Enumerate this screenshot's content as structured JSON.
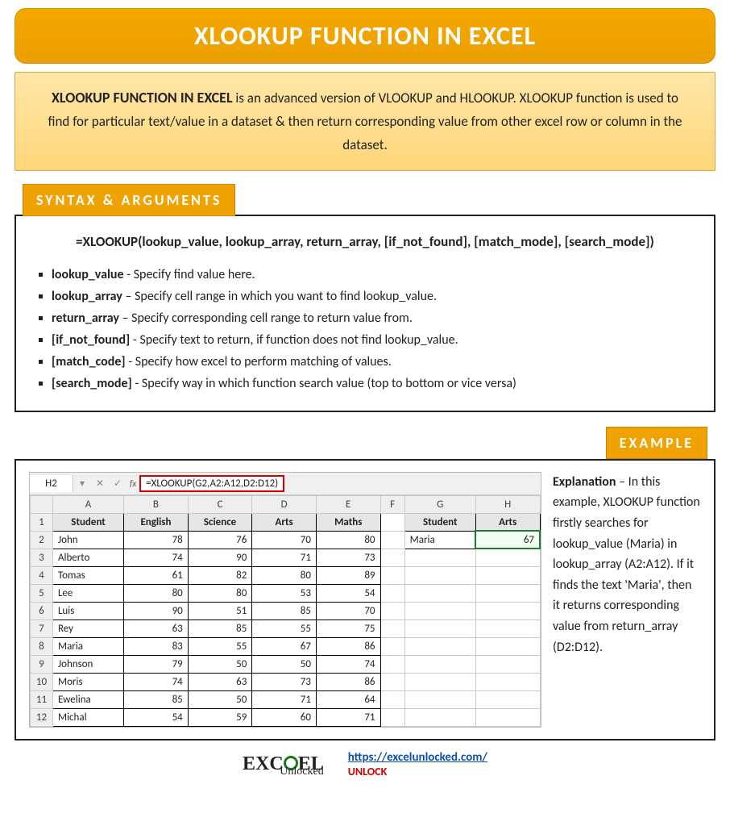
{
  "title": "XLOOKUP FUNCTION IN EXCEL",
  "intro": {
    "lead": "XLOOKUP FUNCTION IN EXCEL",
    "rest": " is an advanced version of VLOOKUP and HLOOKUP. XLOOKUP function is used to find for particular text/value in a dataset & then return corresponding value from other excel row or column in the dataset."
  },
  "sections": {
    "syntax_label": "SYNTAX & ARGUMENTS",
    "example_label": "EXAMPLE"
  },
  "syntax": {
    "formula": "=XLOOKUP(lookup_value, lookup_array, return_array, [if_not_found], [match_mode], [search_mode])",
    "args": [
      {
        "name": "lookup_value",
        "desc": " - Specify find value here."
      },
      {
        "name": "lookup_array",
        "desc": " – Specify cell range in which you want to find lookup_value."
      },
      {
        "name": "return_array",
        "desc": " – Specify corresponding cell range to return value from."
      },
      {
        "name": "[if_not_found]",
        "desc": " - Specify text to return, if function does not find lookup_value."
      },
      {
        "name": "[match_code]",
        "desc": " - Specify how excel to perform matching of values."
      },
      {
        "name": "[search_mode]",
        "desc": " - Specify way in which function search value (top to bottom or vice versa)"
      }
    ]
  },
  "example": {
    "namebox": "H2",
    "formula": "=XLOOKUP(G2,A2:A12,D2:D12)",
    "fx_label": "fx",
    "columns": [
      "A",
      "B",
      "C",
      "D",
      "E",
      "F",
      "G",
      "H"
    ],
    "explanation_title": "Explanation",
    "explanation_body": " – In this example, XLOOKUP function firstly searches for lookup_value (Maria) in lookup_array (A2:A12). If it finds the text 'Maria', then it returns corresponding value from return_array (D2:D12)."
  },
  "chart_data": {
    "type": "table",
    "headers": [
      "Student",
      "English",
      "Science",
      "Arts",
      "Maths"
    ],
    "rows": [
      [
        "John",
        "78",
        "76",
        "70",
        "80"
      ],
      [
        "Alberto",
        "74",
        "90",
        "71",
        "73"
      ],
      [
        "Tomas",
        "61",
        "82",
        "80",
        "89"
      ],
      [
        "Lee",
        "80",
        "80",
        "53",
        "54"
      ],
      [
        "Luis",
        "90",
        "51",
        "85",
        "70"
      ],
      [
        "Rey",
        "63",
        "85",
        "55",
        "75"
      ],
      [
        "Maria",
        "83",
        "55",
        "67",
        "86"
      ],
      [
        "Johnson",
        "79",
        "50",
        "50",
        "74"
      ],
      [
        "Moris",
        "74",
        "63",
        "73",
        "86"
      ],
      [
        "Ewelina",
        "85",
        "50",
        "71",
        "64"
      ],
      [
        "Michal",
        "54",
        "59",
        "60",
        "71"
      ]
    ],
    "lookup_headers": [
      "Student",
      "Arts"
    ],
    "lookup_row": [
      "Maria",
      "67"
    ]
  },
  "footer": {
    "logo_main": "EXC  EL",
    "logo_sub": "Unlocked",
    "url": "https://excelunlocked.com/",
    "unlock": "UNLOCK"
  }
}
